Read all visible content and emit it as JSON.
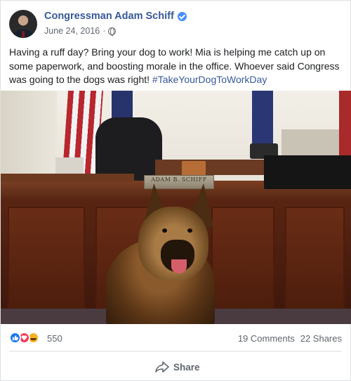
{
  "post": {
    "author": "Congressman Adam Schiff",
    "date": "June 24, 2016",
    "separator": "·",
    "privacy_icon": "globe-icon",
    "verified_icon": "verified-badge-icon",
    "text": "Having a ruff day? Bring your dog to work! Mia is helping me catch up on some paperwork, and boosting morale in the office. Whoever said Congress was going to the dogs was right! ",
    "hashtag": "#TakeYourDogToWorkDay",
    "photo": {
      "nameplate": "ADAM B. SCHIFF"
    }
  },
  "stats": {
    "reaction_icons": [
      "like-icon",
      "love-icon",
      "haha-icon"
    ],
    "reaction_count": "550",
    "comments": "19 Comments",
    "shares": "22 Shares"
  },
  "actions": {
    "share_label": "Share"
  },
  "colors": {
    "link": "#385898",
    "like": "#1877f2",
    "love": "#f33e58",
    "haha": "#f7b125",
    "muted": "#606770"
  }
}
